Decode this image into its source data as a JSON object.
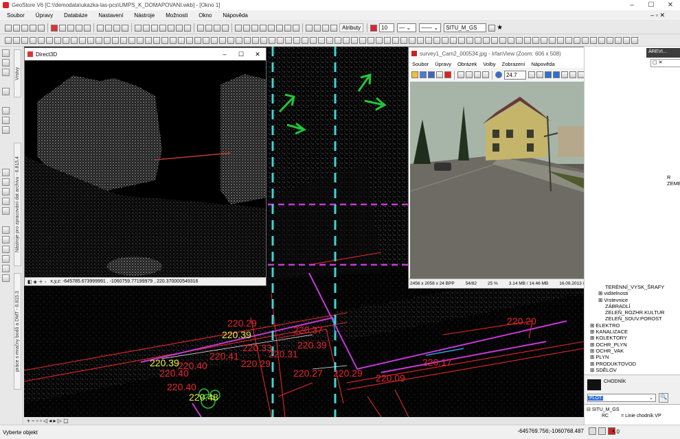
{
  "app": {
    "title": "GeoStore V6 [C:\\!demodata\\ukazka-las-pcs\\UMPS_K_DOMAPOVANI.wkb] - [Okno 1]"
  },
  "menu": [
    "Soubor",
    "Úpravy",
    "Databáze",
    "Nastavení",
    "Nástroje",
    "Možnosti",
    "Okno",
    "Nápověda"
  ],
  "toolbar": {
    "attributes_label": "Atributy",
    "line_width_value": "10",
    "layer_value": "SITU_M_GS"
  },
  "left_panel": {
    "tab_vrstvy": "Vrstvy",
    "tab_nastroje": "Nástroje pro zpracování dat archivu - 6.815.4",
    "tab_pcs": "práce s mračny bodů a DMT - 6.815.3"
  },
  "direct3d": {
    "title": "Direct3D",
    "status": "x,y,z: -645785.673999991 , -1060759.77199979 , 220.370000549316"
  },
  "irfanview": {
    "title": "survey1_Cam2_000534.jpg - IrfanView (Zoom: 606 x 508)",
    "menu": [
      "Soubor",
      "Úpravy",
      "Obrázek",
      "Volby",
      "Zobrazení",
      "Nápověda"
    ],
    "zoom_value": "24.7",
    "status": {
      "size": "2456 x 2058 x 24 BPP",
      "index": "54/82",
      "zoom": "25 %",
      "filesize": "3.14 MB / 14.46 MB",
      "datetime": "16.09.2013 / 14:26:40"
    }
  },
  "map_labels": {
    "red": [
      "220.29",
      "220.37",
      "220.39",
      "220.33",
      "220.41",
      "220.31",
      "220.29",
      "220.40",
      "220.40",
      "220.40",
      "220.27",
      "220.29",
      "220.09",
      "220.17",
      "220.20"
    ],
    "yellow": [
      "220.39",
      "220.39",
      "220.48"
    ]
  },
  "right_panel": {
    "header": "ÁREVI...",
    "tree_top": [
      "R",
      "ZEMEK"
    ],
    "tree_items": [
      "TERÉNNÍ_VYSK_ŠRAFY",
      "viditelnosti",
      "Vrstevnice",
      "ZÁBRADLÍ",
      "ZELEŇ_ROZHR.KULTUR",
      "ZELEŇ_SOUV.POROST",
      "ELEKTRO",
      "KANALIZACE",
      "KOLEKTORY",
      "OCHR_PLYN",
      "OCHR_VAK",
      "PLYN",
      "PRODUKTOVOD",
      "SDĚLOV"
    ],
    "style_name": "CHODNÍK",
    "plot_select": "PLOT",
    "layer_root": "SITU_M_GS",
    "layer_row_code": "RC",
    "layer_row_desc": "= Linie chodník VP"
  },
  "status": {
    "message": "Vyberte objekt",
    "coords": "-645769.756;-1060768.487",
    "count": "0"
  },
  "colors": {
    "map_bg": "#030303",
    "red_line": "#e8262d",
    "magenta_line": "#c838d8",
    "cyan_dash": "#3fd6d6",
    "arrow_green": "#22c53a"
  }
}
